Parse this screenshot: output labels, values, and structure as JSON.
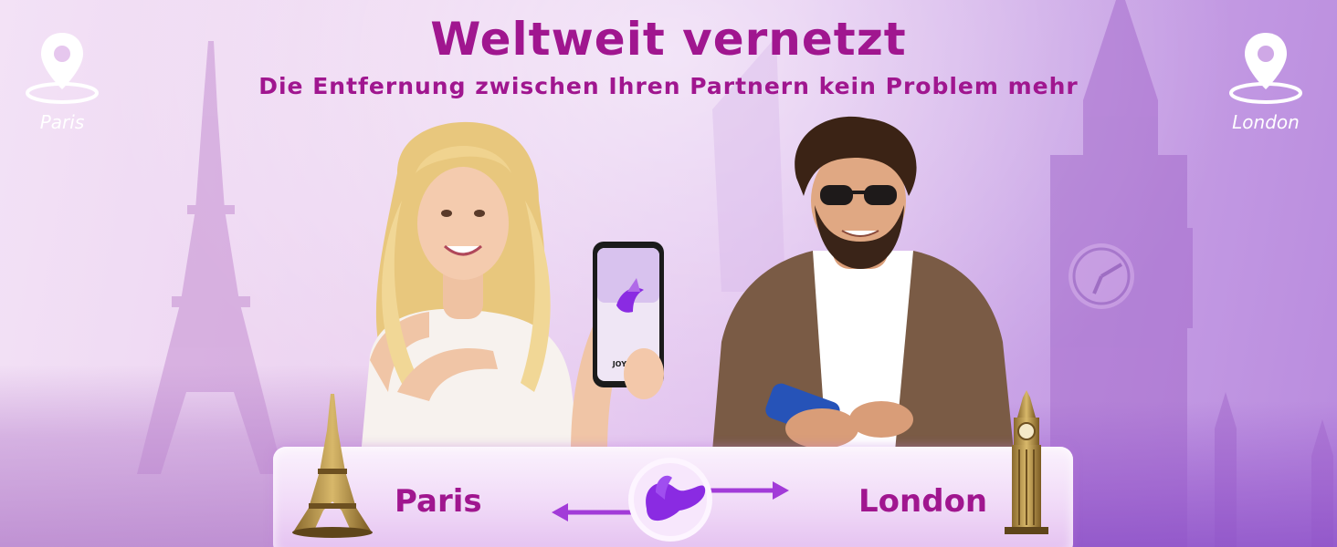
{
  "header": {
    "title": "Weltweit vernetzt",
    "subtitle": "Die Entfernung zwischen Ihren Partnern kein Problem mehr"
  },
  "locations": {
    "left_pin_label": "Paris",
    "right_pin_label": "London"
  },
  "phone": {
    "brand_text": "JOYHUB"
  },
  "connection_card": {
    "left_city": "Paris",
    "right_city": "London"
  },
  "colors": {
    "accent": "#a0168f",
    "product": "#8a2be2",
    "background_light": "#f3e2f6",
    "background_dark": "#b98bde"
  },
  "icons": [
    "map-pin-icon",
    "eiffel-tower-icon",
    "big-ben-icon",
    "arrow-left-icon",
    "arrow-right-icon",
    "app-logo-icon"
  ]
}
